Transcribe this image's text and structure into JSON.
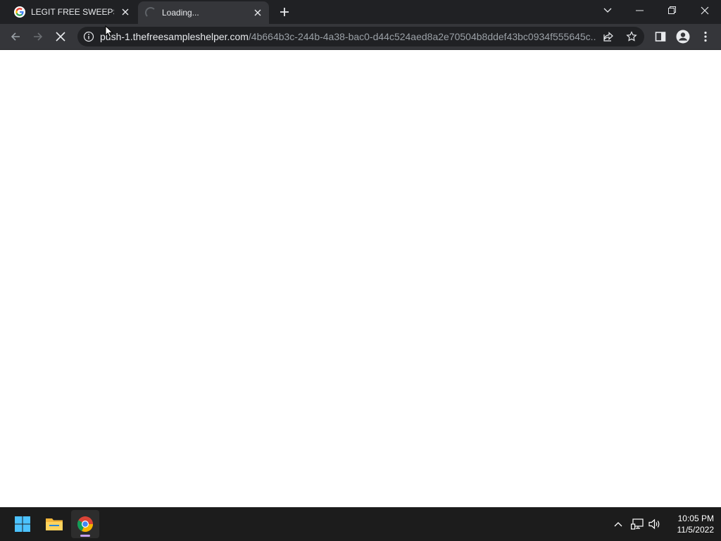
{
  "tabs": [
    {
      "title": "LEGIT FREE SWEEPSTAKES",
      "favicon": "google-g-icon",
      "state": "inactive"
    },
    {
      "title": "Loading...",
      "favicon": "loading-spinner-icon",
      "state": "active"
    }
  ],
  "new_tab_icon": "plus-icon",
  "window_controls": [
    "tab-search-chevron-icon",
    "minimize-icon",
    "restore-icon",
    "close-icon"
  ],
  "address_bar": {
    "host": "push-1.thefreesampleshelper.com",
    "path": "/4b664b3c-244b-4a38-bac0-d44c524aed8a2e70504b8ddef43bc0934f555645c...",
    "site_info_icon": "info-icon"
  },
  "toolbar_icons": [
    "back-icon",
    "forward-icon",
    "stop-loading-icon",
    "share-icon",
    "bookmark-star-icon",
    "side-panel-icon",
    "profile-icon",
    "menu-dots-icon"
  ],
  "taskbar": {
    "apps": [
      "windows-start-icon",
      "file-explorer-icon",
      "chrome-icon"
    ],
    "tray_icons": [
      "show-hidden-chevron-icon",
      "network-icon",
      "volume-icon"
    ],
    "time": "10:05 PM",
    "date": "11/5/2022"
  },
  "colors": {
    "tabstrip_bg": "#202124",
    "toolbar_bg": "#35363a",
    "omnibox_bg": "#202124",
    "url_host": "#e8eaed",
    "url_path": "#9aa0a6",
    "taskbar_bg": "#1c1c1c",
    "page_bg": "#ffffff"
  }
}
